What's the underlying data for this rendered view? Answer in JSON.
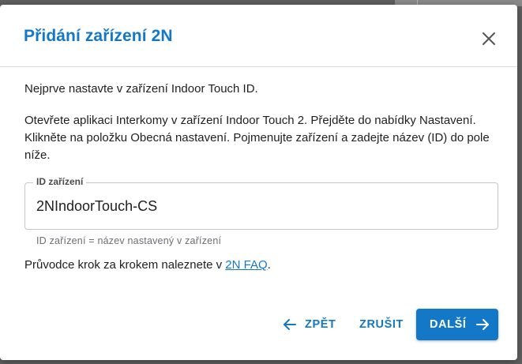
{
  "dialog": {
    "title": "Přidání zařízení 2N",
    "close_icon": "close-icon",
    "intro": "Nejprve nastavte v zařízení Indoor Touch ID.",
    "instructions": "Otevřete aplikaci Interkomy v zařízení Indoor Touch 2. Přejděte do nabídky Nastavení. Klikněte na položku Obecná nastavení. Pojmenujte zařízení a zadejte název (ID) do pole níže.",
    "id_field": {
      "label": "ID zařízení",
      "value": "2NIndoorTouch-CS",
      "helper": "ID zařízení = název nastavený v zařízení"
    },
    "faq": {
      "prefix": "Průvodce krok za krokem naleznete v ",
      "link_text": "2N FAQ",
      "suffix": "."
    },
    "buttons": {
      "back_label": "ZPĚT",
      "back_icon": "arrow-left-icon",
      "cancel_label": "ZRUŠIT",
      "next_label": "DALŠÍ",
      "next_icon": "arrow-right-icon"
    }
  },
  "colors": {
    "accent": "#1478c8",
    "text": "#1f1f1f",
    "helper_text": "#6b6f74",
    "border": "#c4c8cd",
    "backdrop": "#5f5f5f"
  }
}
